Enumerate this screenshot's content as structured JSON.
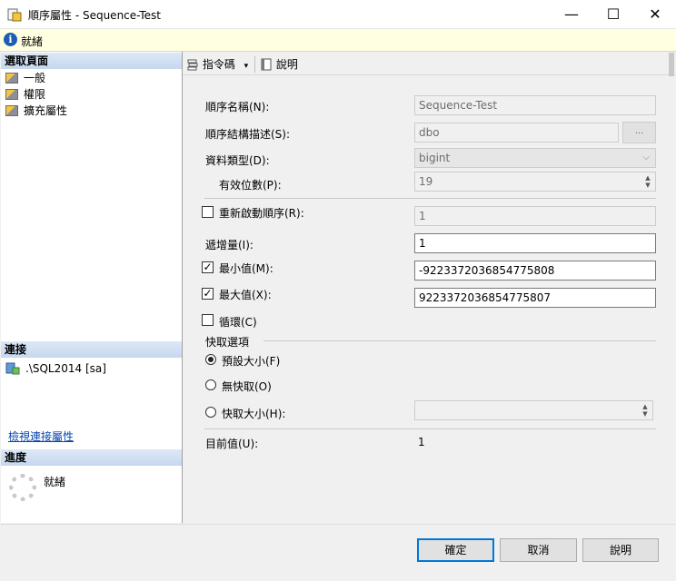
{
  "window": {
    "title": "順序屬性 - Sequence-Test",
    "minimize_glyph": "—",
    "maximize_glyph": "☐",
    "close_glyph": "✕"
  },
  "status": {
    "text": "就緒",
    "icon": "info-icon"
  },
  "left_pane": {
    "select_page_header": "選取頁面",
    "pages": [
      "一般",
      "權限",
      "擴充屬性"
    ],
    "connection_header": "連接",
    "server": ".\\SQL2014 [sa]",
    "view_connection_link": "檢視連接屬性",
    "progress_header": "進度",
    "progress_text": "就緒"
  },
  "toolbar": {
    "script_label": "指令碼",
    "help_label": "說明"
  },
  "form": {
    "sequence_name_label": "順序名稱(N):",
    "sequence_name_value": "Sequence-Test",
    "schema_label": "順序結構描述(S):",
    "schema_value": "dbo",
    "browse_label": "...",
    "data_type_label": "資料類型(D):",
    "data_type_value": "bigint",
    "precision_label": "有效位數(P):",
    "precision_value": "19",
    "restart_label": "重新啟動順序(R):",
    "restart_checked": false,
    "restart_value": "1",
    "increment_label": "遞增量(I):",
    "increment_value": "1",
    "min_label": "最小值(M):",
    "min_checked": true,
    "min_value": "-9223372036854775808",
    "max_label": "最大值(X):",
    "max_checked": true,
    "max_value": "9223372036854775807",
    "cycle_label": "循環(C)",
    "cycle_checked": false,
    "cache_group_label": "快取選項",
    "cache_default_label": "預設大小(F)",
    "cache_none_label": "無快取(O)",
    "cache_size_label": "快取大小(H):",
    "cache_selected": "default",
    "cache_size_value": "",
    "current_value_label": "目前值(U):",
    "current_value": "1"
  },
  "buttons": {
    "ok": "確定",
    "cancel": "取消",
    "help": "說明"
  }
}
